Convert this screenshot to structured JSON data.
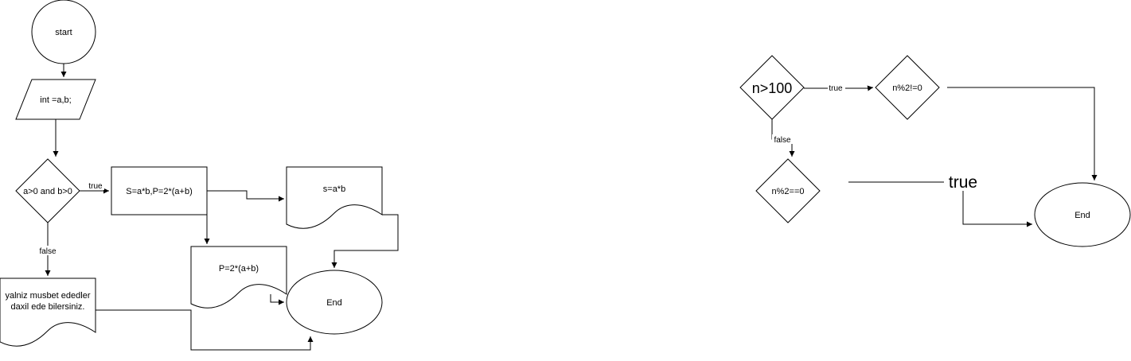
{
  "diagram": {
    "left_flow": {
      "start": "start",
      "input": "int =a,b;",
      "condition": "a>0 and b>0",
      "process": "S=a*b,P=2*(a+b)",
      "doc_s": "s=a*b",
      "doc_p": "P=2*(a+b)",
      "doc_error_line1": "yalniz musbet ededler",
      "doc_error_line2": "daxil ede bilersiniz.",
      "end": "End",
      "edge_true": "true",
      "edge_false": "false"
    },
    "right_flow": {
      "cond_n": "n>100",
      "cond_odd": "n%2!=0",
      "cond_even": "n%2==0",
      "end": "End",
      "edge_true": "true",
      "edge_false": "false",
      "edge_true_large": "true"
    }
  }
}
